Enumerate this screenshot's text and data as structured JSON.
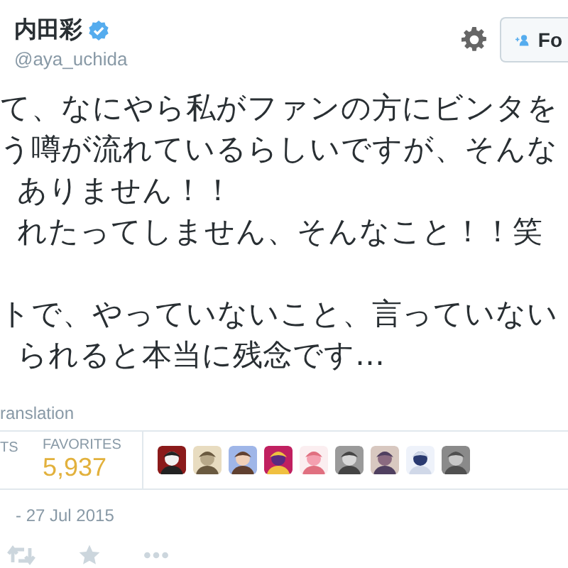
{
  "header": {
    "name": "内田彩",
    "verified": true,
    "handle": "@aya_uchida",
    "follow_button": "Fo"
  },
  "tweet_paragraphs": [
    [
      "て、なにやら私がファンの方にビンタを",
      "う噂が流れているらしいですが、そんな",
      "ありません！！",
      "れたってしません、そんなこと！！笑"
    ],
    [
      "トで、やっていないこと、言っていない",
      "られると本当に残念です…"
    ]
  ],
  "translation_link": "ranslation",
  "stats": [
    {
      "label": "TS"
    },
    {
      "label": "FAVORITES",
      "value": "5,937"
    }
  ],
  "timestamp": "- 27 Jul 2015"
}
